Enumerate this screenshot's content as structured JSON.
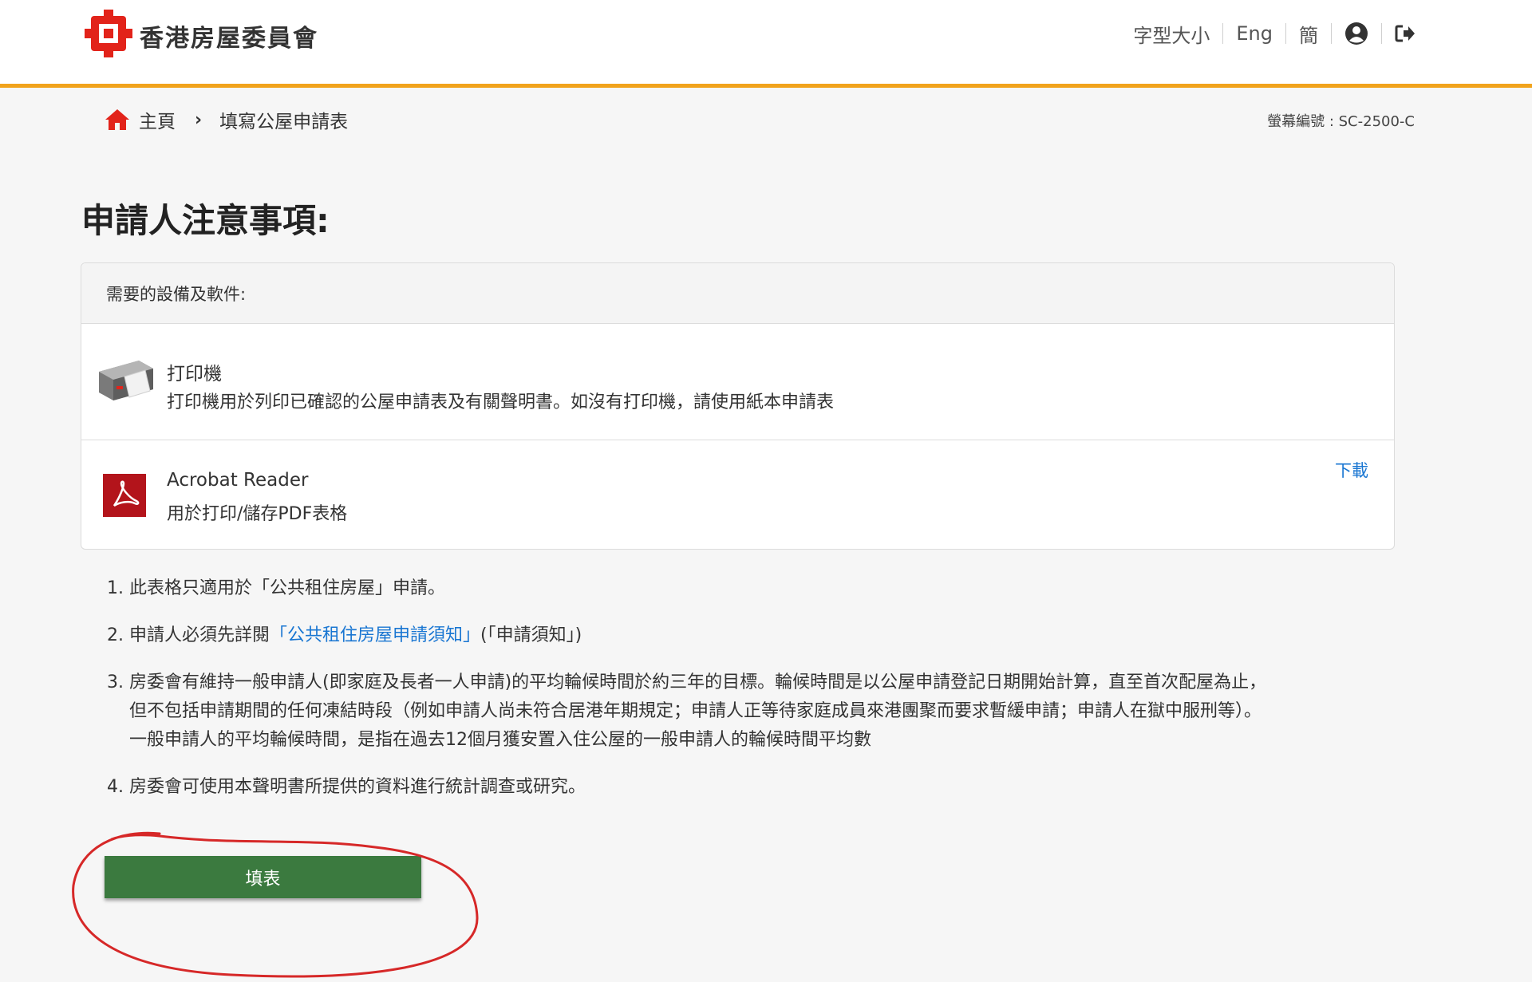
{
  "header": {
    "brand": "香港房屋委員會",
    "font_size_label": "字型大小",
    "lang_en": "Eng",
    "lang_sc": "簡",
    "accent_color": "#f1a31c",
    "logo_color": "#e2231a",
    "icons": [
      "user-icon",
      "logout-icon"
    ]
  },
  "breadcrumb": {
    "home": "主頁",
    "current": "填寫公屋申請表"
  },
  "screen_id": "螢幕編號 : SC-2500-C",
  "title": "申請人注意事項:",
  "requirements": {
    "header": "需要的設備及軟件:",
    "items": [
      {
        "icon": "printer-icon",
        "name": "打印機",
        "desc": "打印機用於列印已確認的公屋申請表及有關聲明書。如沒有打印機，請使用紙本申請表"
      },
      {
        "icon": "acrobat-icon",
        "name": "Acrobat Reader",
        "desc": "用於打印/儲存PDF表格",
        "link": "下載"
      }
    ]
  },
  "notes": [
    {
      "num": "1.",
      "text": "此表格只適用於「公共租住房屋」申請。"
    },
    {
      "num": "2.",
      "pre": "申請人必須先詳閱",
      "link": "「公共租住房屋申請須知」",
      "post": "(「申請須知」)"
    },
    {
      "num": "3.",
      "lines": [
        "房委會有維持一般申請人(即家庭及長者一人申請)的平均輪候時間於約三年的目標。輪候時間是以公屋申請登記日期開始計算，直至首次配屋為止，",
        "但不包括申請期間的任何凍結時段（例如申請人尚未符合居港年期規定；申請人正等待家庭成員來港團聚而要求暫緩申請；申請人在獄中服刑等）。",
        "一般申請人的平均輪候時間，是指在過去12個月獲安置入住公屋的一般申請人的輪候時間平均數"
      ]
    },
    {
      "num": "4.",
      "text": "房委會可使用本聲明書所提供的資料進行統計調查或研究。"
    }
  ],
  "fill_button": "填表",
  "button_color": "#3b7a3f",
  "link_color": "#1976d2",
  "annotation_color": "#d62828"
}
